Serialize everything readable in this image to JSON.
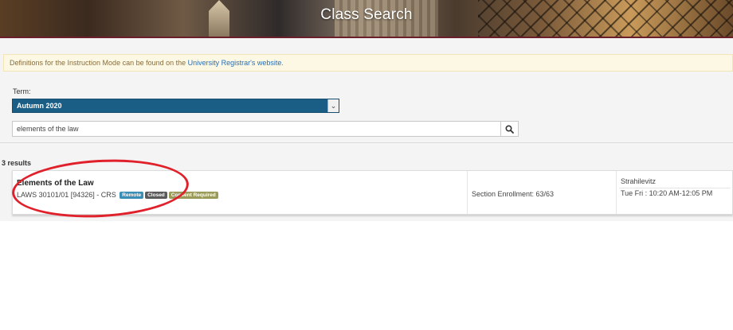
{
  "header": {
    "title": "Class Search"
  },
  "alert": {
    "text": "Definitions for the Instruction Mode can be found on the ",
    "link_text": "University Registrar's website",
    "suffix": "."
  },
  "term": {
    "label": "Term:",
    "selected": "Autumn 2020"
  },
  "search": {
    "value": "elements of the law"
  },
  "results": {
    "count_text": "3 results",
    "items": [
      {
        "title": "Elements of the Law",
        "code": "LAWS 30101/01 [94326] - CRS",
        "badges": [
          "Remote",
          "Closed",
          "Consent Required"
        ],
        "enrollment": "Section Enrollment: 63/63",
        "instructor": "Strahilevitz",
        "schedule": "Tue Fri : 10:20 AM-12:05 PM"
      }
    ]
  },
  "colors": {
    "term_select_bg": "#1a5e86",
    "alert_bg": "#fcf8e3",
    "link": "#2a6fb5",
    "badge_remote": "#3a8fb7",
    "badge_closed": "#5a5a5a",
    "badge_consent": "#9a9a5a",
    "annotation_circle": "#e0202a"
  },
  "icons": {
    "search_button": "search-icon",
    "term_dropdown": "chevron-down-icon"
  }
}
